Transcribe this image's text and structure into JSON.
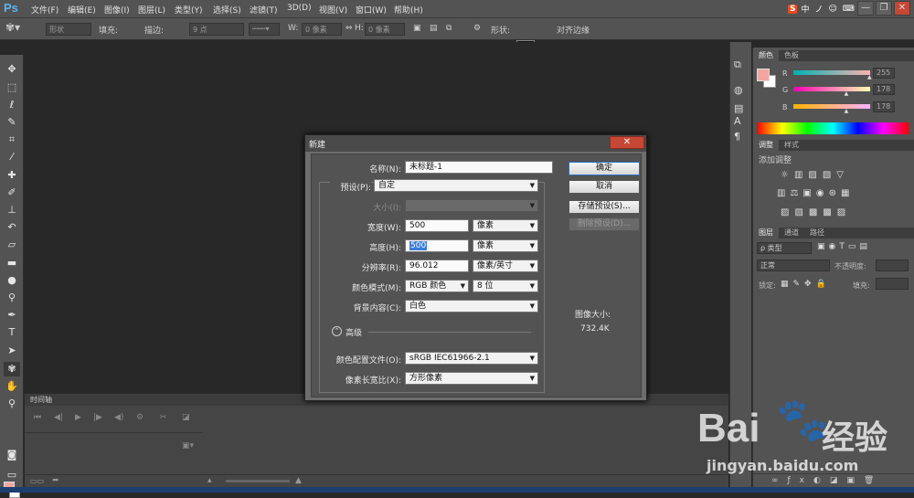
{
  "app": {
    "logo": "Ps"
  },
  "menu": [
    "文件(F)",
    "编辑(E)",
    "图像(I)",
    "图层(L)",
    "类型(Y)",
    "选择(S)",
    "滤镜(T)",
    "3D(D)",
    "视图(V)",
    "窗口(W)",
    "帮助(H)"
  ],
  "ime": {
    "brand": "S",
    "lang": "中",
    "items": [
      "ノ",
      "☺",
      "⌨",
      "✦",
      "👕",
      "⋮⋮"
    ]
  },
  "window_controls": [
    "—",
    "❐",
    "✕"
  ],
  "options_bar": {
    "mode": "形状",
    "fill_label": "填充:",
    "stroke_label": "描边:",
    "stroke_size": "9 点",
    "w_label": "W:",
    "w_value": "0 像素",
    "link": "⇔",
    "h_label": "H:",
    "h_value": "0 像素",
    "shape_label": "形状:",
    "align_label": "对齐边缘"
  },
  "timeline": {
    "tab": "时间轴",
    "controls": [
      "⏮",
      "◀|",
      "▶",
      "|▶",
      "◀)",
      "⚙",
      "✂",
      "◪"
    ]
  },
  "color_panel": {
    "tabs": [
      "颜色",
      "色板"
    ],
    "channels": [
      {
        "label": "R",
        "value": "255",
        "position": 1.0
      },
      {
        "label": "G",
        "value": "178",
        "position": 0.698
      },
      {
        "label": "B",
        "value": "178",
        "position": 0.698
      }
    ]
  },
  "adjust_panel": {
    "tabs": [
      "调整",
      "样式"
    ],
    "title": "添加调整"
  },
  "layers_panel": {
    "tabs": [
      "图层",
      "通道",
      "路径"
    ],
    "filter": "ρ 类型",
    "blend": "正常",
    "opacity_label": "不透明度:",
    "lock_label": "锁定:",
    "fill_label": "填充:"
  },
  "dialog": {
    "title": "新建",
    "close": "✕",
    "name_label": "名称(N):",
    "name_value": "未标题-1",
    "preset_label": "预设(P):",
    "preset_value": "自定",
    "size_label": "大小(I):",
    "width_label": "宽度(W):",
    "width_value": "500",
    "width_unit": "像素",
    "height_label": "高度(H):",
    "height_value": "500",
    "height_unit": "像素",
    "resolution_label": "分辨率(R):",
    "resolution_value": "96.012",
    "resolution_unit": "像素/英寸",
    "color_mode_label": "颜色模式(M):",
    "color_mode_value": "RGB 颜色",
    "bit_depth": "8 位",
    "bg_label": "背景内容(C):",
    "bg_value": "白色",
    "advanced": "高级",
    "profile_label": "颜色配置文件(O):",
    "profile_value": "sRGB IEC61966-2.1",
    "aspect_label": "像素长宽比(X):",
    "aspect_value": "方形像素",
    "ok": "确定",
    "cancel": "取消",
    "save_preset": "存储预设(S)...",
    "delete_preset": "删除预设(D)...",
    "image_size_label": "图像大小:",
    "image_size_value": "732.4K"
  },
  "watermark": {
    "brand": "Bai",
    "brand2": "经验",
    "url": "jingyan.baidu.com"
  },
  "colors": {
    "foreground": "#f2a6a2",
    "background": "#ffffff",
    "accent": "#3c7dd9"
  }
}
